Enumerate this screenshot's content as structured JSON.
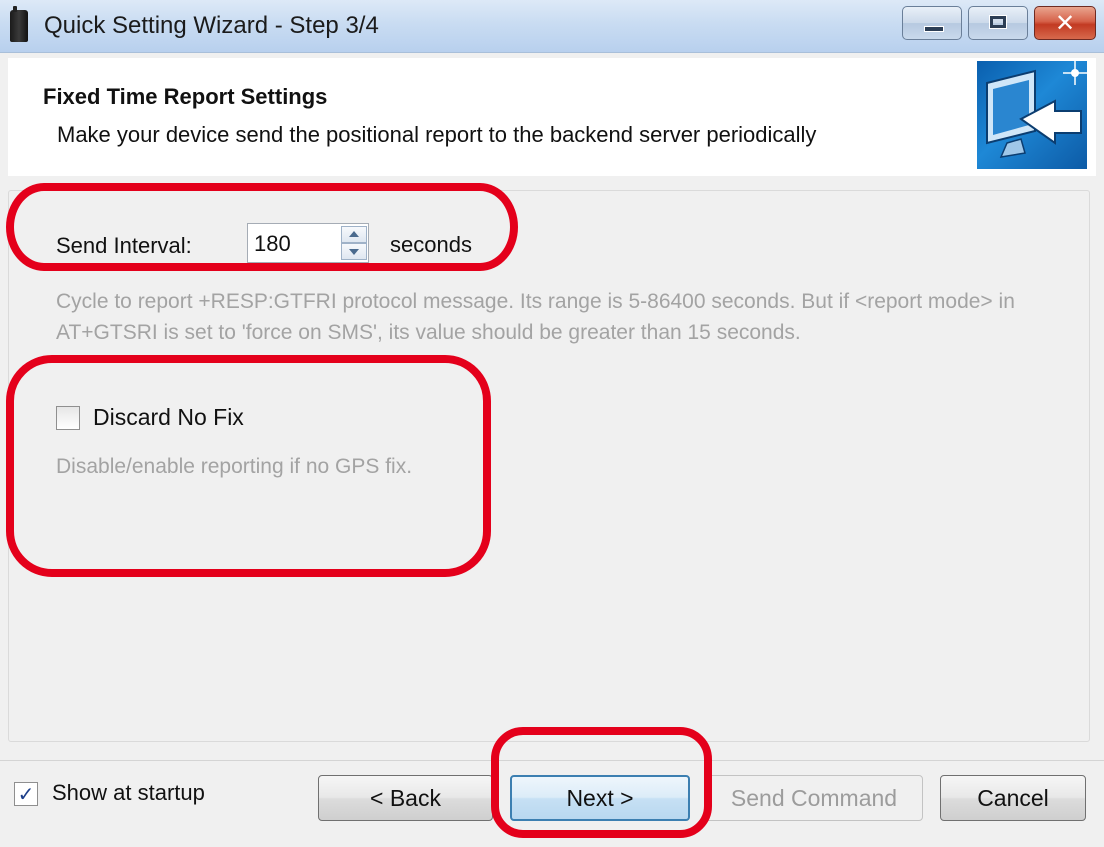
{
  "window": {
    "title": "Quick Setting Wizard - Step 3/4",
    "controls": [
      "minimize-icon",
      "maximize-icon",
      "close-icon"
    ],
    "close_glyph": "✕"
  },
  "header": {
    "title": "Fixed Time Report Settings",
    "description": "Make your device send the positional report to the backend server periodically",
    "icon": "monitor-arrow-icon"
  },
  "send_interval": {
    "label": "Send Interval:",
    "value": "180",
    "unit": "seconds",
    "help": "Cycle to report +RESP:GTFRI protocol message. Its range is 5-86400 seconds. But if <report mode> in AT+GTSRI is set to 'force on SMS', its value should be greater than 15 seconds."
  },
  "discard_no_fix": {
    "label": "Discard No Fix",
    "checked": false,
    "help": "Disable/enable reporting if no GPS fix."
  },
  "footer": {
    "show_at_startup_label": "Show at startup",
    "show_at_startup_checked": true,
    "checkmark": "✓",
    "back_label": "< Back",
    "next_label": "Next >",
    "send_command_label": "Send Command",
    "cancel_label": "Cancel"
  },
  "colors": {
    "annotation": "#e4001b",
    "help_text": "#a3a3a3",
    "title_bar": "#c9dcf2",
    "close_button": "#c23a22"
  }
}
